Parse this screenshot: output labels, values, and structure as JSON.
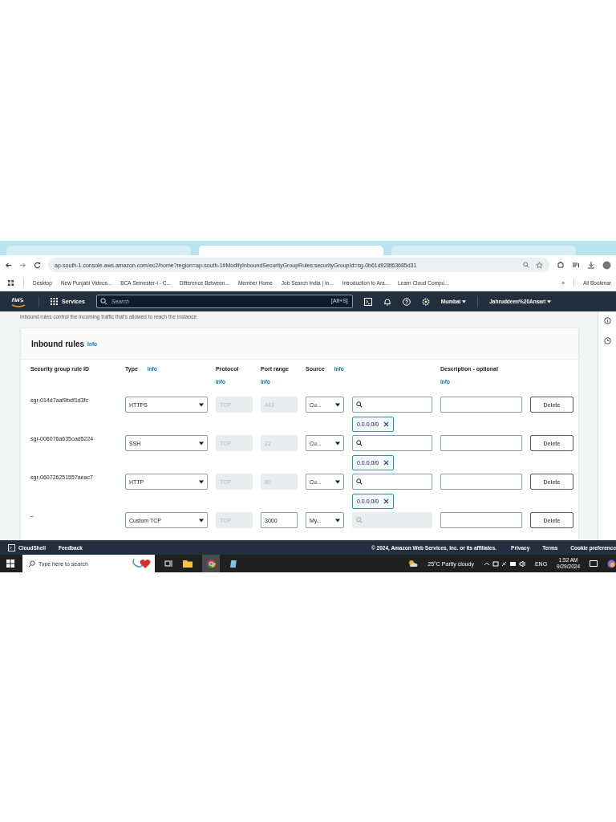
{
  "browser": {
    "tabs": [
      {
        "selected": false
      },
      {
        "selected": true
      },
      {
        "selected": false
      }
    ],
    "url": "ap-south-1.console.aws.amazon.com/ec2/home?region=ap-south-1#ModifyInboundSecurityGroupRules:securityGroupId=sg-0b61d928f63685d31",
    "bookmarks": [
      "Desktop",
      "New Punjabi Videos...",
      "BCA Semester-I - C...",
      "Difference Between...",
      "Member Home",
      "Job Search India | In...",
      "Introduction to Ara...",
      "Learn Cloud Compu..."
    ],
    "bookmarks_more": "»",
    "all_bookmarks": "All Bookmar"
  },
  "nav": {
    "services": "Services",
    "search_placeholder": "Search",
    "shortcut": "[Alt+S]",
    "region": "Mumbai",
    "user": "Jahruddeen%20Ansari"
  },
  "intro": "Inbound rules control the incoming traffic that's allowed to reach the instance.",
  "panel": {
    "title": "Inbound rules",
    "info": "Info",
    "columns": [
      {
        "label": "Security group rule ID"
      },
      {
        "label": "Type",
        "info": "Info",
        "kind": "inline"
      },
      {
        "label": "Protocol",
        "info": "Info",
        "kind": "below"
      },
      {
        "label": "Port range",
        "info": "Info",
        "kind": "below"
      },
      {
        "label": "Source",
        "info": "Info",
        "kind": "inline"
      },
      {
        "label": "Description - optional",
        "info": "Info",
        "kind": "below"
      }
    ],
    "rules": [
      {
        "rule_id": "sgr-014d7aaf9bdf1d3fc",
        "type": "HTTPS",
        "protocol": "TCP",
        "port": "443",
        "port_disabled": true,
        "source": "Cu...",
        "search_disabled": false,
        "cidr": "0.0.0.0/0",
        "delete": "Delete"
      },
      {
        "rule_id": "sgr-006076a635oad5224",
        "type": "SSH",
        "protocol": "TCP",
        "port": "22",
        "port_disabled": true,
        "source": "Cu...",
        "search_disabled": false,
        "cidr": "0.0.0.0/0",
        "delete": "Delete"
      },
      {
        "rule_id": "sgr-060726251557aeac7",
        "type": "HTTP",
        "protocol": "TCP",
        "port": "80",
        "port_disabled": true,
        "source": "Cu...",
        "search_disabled": false,
        "cidr": "0.0.0.0/0",
        "delete": "Delete"
      },
      {
        "rule_id": "–",
        "type": "Custom TCP",
        "protocol": "TCP",
        "port": "3000",
        "port_disabled": false,
        "source": "My...",
        "search_disabled": true,
        "delete": "Delete"
      }
    ]
  },
  "footer": {
    "cloudshell": "CloudShell",
    "feedback": "Feedback",
    "copyright": "© 2024, Amazon Web Services, Inc. or its affiliates.",
    "links": [
      "Privacy",
      "Terms",
      "Cookie preference"
    ]
  },
  "taskbar": {
    "search_placeholder": "Type here to search",
    "weather": "25°C  Partly cloudy",
    "language": "ENG",
    "time": "1:52 AM",
    "date": "9/29/2024"
  }
}
